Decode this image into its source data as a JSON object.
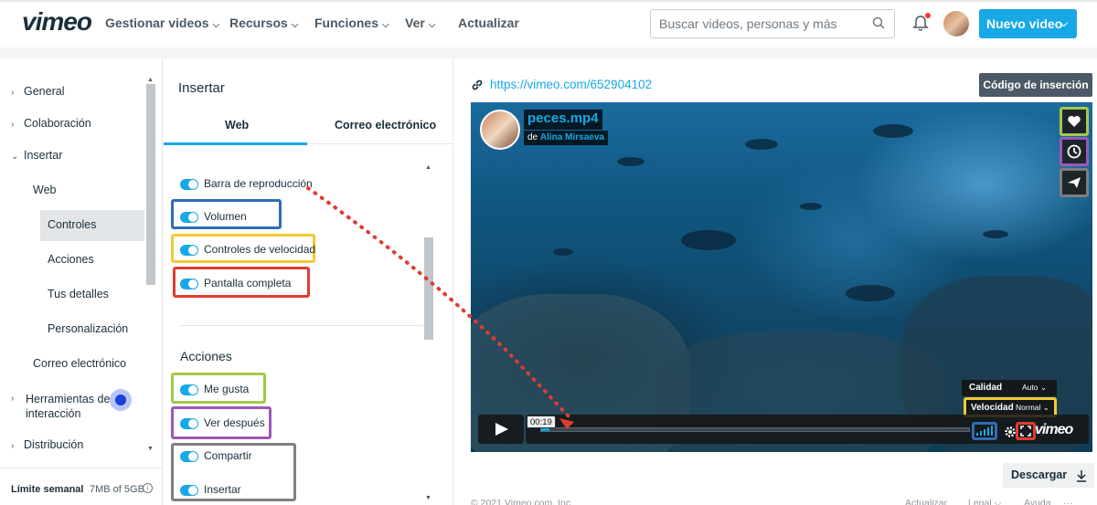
{
  "nav": {
    "logo": "vimeo",
    "items": [
      {
        "label": "Gestionar videos",
        "chev": "⌵"
      },
      {
        "label": "Recursos",
        "chev": "⌵"
      },
      {
        "label": "Funciones",
        "chev": "⌵"
      },
      {
        "label": "Ver",
        "chev": "⌵"
      },
      {
        "label": "Actualizar",
        "chev": ""
      }
    ],
    "search_placeholder": "Buscar videos, personas y más",
    "new_video": "Nuevo video",
    "accent": "#17a8e6"
  },
  "sidebar": {
    "items": [
      {
        "label": "General",
        "arrow": "›"
      },
      {
        "label": "Colaboración",
        "arrow": "›"
      },
      {
        "label": "Insertar",
        "arrow": "⌄"
      },
      {
        "label": "Web",
        "arrow": ""
      },
      {
        "label": "Controles",
        "arrow": ""
      },
      {
        "label": "Acciones",
        "arrow": ""
      },
      {
        "label": "Tus detalles",
        "arrow": ""
      },
      {
        "label": "Personalización",
        "arrow": ""
      },
      {
        "label": "Correo electrónico",
        "arrow": ""
      },
      {
        "label": "Herramientas de interacción",
        "arrow": "›"
      },
      {
        "label": "Distribución",
        "arrow": "›"
      }
    ],
    "limit_label": "Límite semanal",
    "limit_value": "7MB of 5GB",
    "info_glyph": "i"
  },
  "panel": {
    "title": "Insertar",
    "tabs": [
      "Web",
      "Correo electrónico"
    ],
    "controls": [
      {
        "label": "Barra de reproducción",
        "on": true
      },
      {
        "label": "Volumen",
        "on": true
      },
      {
        "label": "Controles de velocidad",
        "on": true
      },
      {
        "label": "Pantalla completa",
        "on": true
      }
    ],
    "actions_title": "Acciones",
    "actions": [
      {
        "label": "Me gusta",
        "on": true
      },
      {
        "label": "Ver después",
        "on": true
      },
      {
        "label": "Compartir",
        "on": true
      },
      {
        "label": "Insertar",
        "on": true
      }
    ],
    "highlight_colors": {
      "blue": "#2f6db5",
      "yellow": "#f3c934",
      "red": "#e03c31",
      "green": "#a4c84a",
      "purple": "#9b59b6",
      "gray": "#7f7f7f"
    }
  },
  "preview": {
    "url": "https://vimeo.com/652904102",
    "embed_button": "Código de inserción",
    "video_title": "peces.mp4",
    "by_prefix": "de",
    "author": "Alina Mirsaeva",
    "quality_label": "Calidad",
    "quality_value": "Auto ⌄",
    "speed_label": "Velocidad",
    "speed_value": "Normal ⌄",
    "time": "00:19",
    "progress_fraction": 0.02,
    "vimeo_mark": "vimeo",
    "download": "Descargar",
    "footer_copy": "© 2021 Vimeo.com, Inc.",
    "footer_links": [
      "Actualizar",
      "Legal ⌵",
      "Ayuda",
      "···"
    ]
  }
}
